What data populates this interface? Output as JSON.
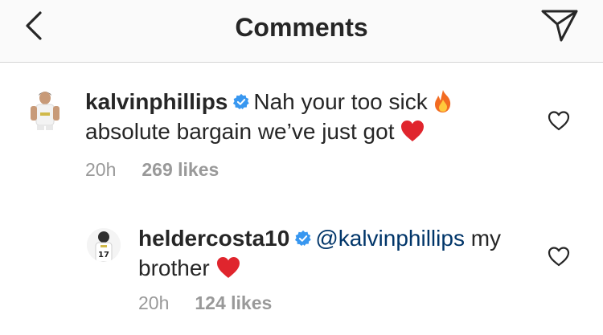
{
  "header": {
    "title": "Comments",
    "back_icon": "chevron-left-icon",
    "direct_icon": "paper-plane-icon"
  },
  "comments": [
    {
      "username": "kalvinphillips",
      "verified": true,
      "text_line1": "Nah your too sick",
      "emoji1": "fire-emoji",
      "text_line2": "absolute bargain we’ve just got",
      "emoji2": "red-heart-emoji",
      "time": "20h",
      "likes": "269 likes"
    },
    {
      "username": "heldercosta10",
      "verified": true,
      "mention": "@kalvinphillips",
      "text_after_mention": "my",
      "text_line2": "brother",
      "emoji": "red-heart-emoji",
      "time": "20h",
      "likes": "124 likes"
    }
  ],
  "colors": {
    "text": "#262626",
    "secondary": "#999999",
    "mention": "#003569",
    "verified": "#3897f0",
    "heart": "#e0252d",
    "header_bg": "#fafafa"
  }
}
